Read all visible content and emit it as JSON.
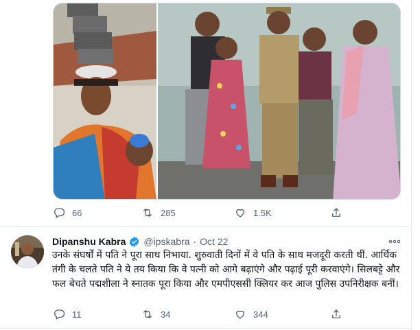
{
  "tweet_top": {
    "actions": {
      "replies": "66",
      "retweets": "285",
      "likes": "1.5K"
    }
  },
  "tweet_second": {
    "author_name": "Dipanshu Kabra",
    "handle": "@ipskabra",
    "separator": "·",
    "date": "Oct 22",
    "text": "उनके संघर्षों में पति ने पूरा साथ निभाया. शुरुवाती दिनों में वे पति के साथ मजदूरी करती थीं. आर्थिक तंगी के चलते पति ने ये तय किया कि वे पत्नी को आगे बढ़ाएंगे और पढ़ाई पूरी करवाएंगे। सिलबट्टे और फल बेचते पद्मशीला ने स्नातक पूरा किया और एमपीएससी क्लियर कर आज पुलिस उपनिरीक्षक बनीं।",
    "actions": {
      "replies": "11",
      "retweets": "34",
      "likes": "344"
    }
  },
  "colors": {
    "icon_gray": "#536471",
    "verified_blue": "#1d9bf0",
    "divider": "#e6ecf0"
  },
  "icons": [
    "reply-icon",
    "retweet-icon",
    "like-icon",
    "share-icon",
    "verified-badge-icon",
    "more-icon"
  ]
}
